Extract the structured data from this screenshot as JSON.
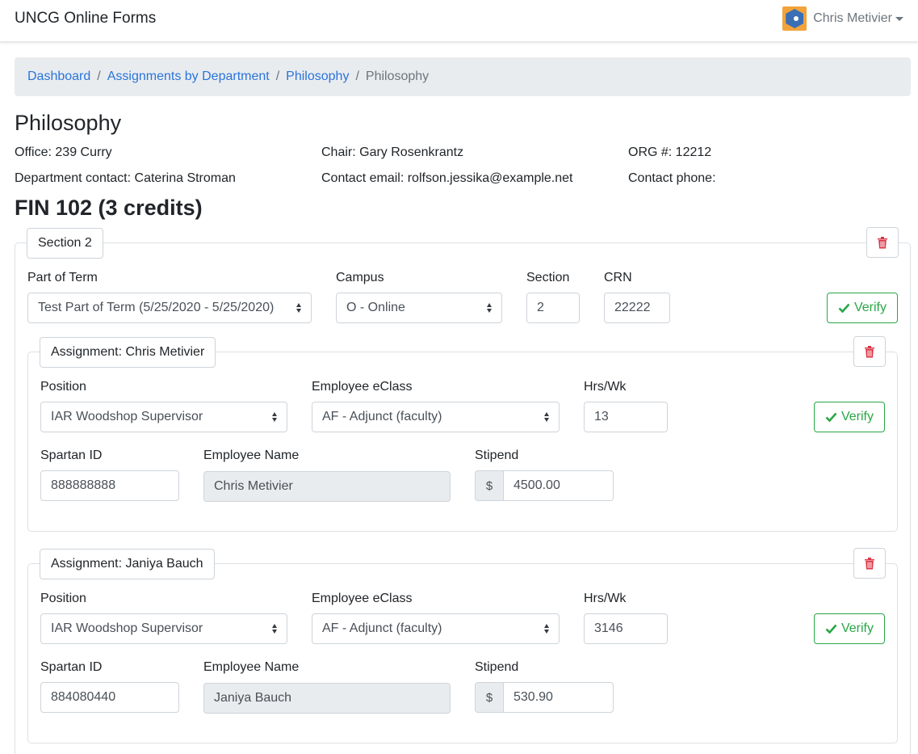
{
  "navbar": {
    "brand": "UNCG Online Forms",
    "user_name": "Chris Metivier",
    "avatar_icon": "avatar-icon"
  },
  "breadcrumb": {
    "items": [
      "Dashboard",
      "Assignments by Department",
      "Philosophy"
    ],
    "active": "Philosophy",
    "separator": "/"
  },
  "department": {
    "title": "Philosophy",
    "office": "Office: 239 Curry",
    "chair": "Chair: Gary Rosenkrantz",
    "org": "ORG #: 12212",
    "contact": "Department contact: Caterina Stroman",
    "email": "Contact email: rolfson.jessika@example.net",
    "phone": "Contact phone:"
  },
  "course": {
    "title": "FIN 102 (3 credits)",
    "section": {
      "legend": "Section 2",
      "labels": {
        "part_of_term": "Part of Term",
        "campus": "Campus",
        "section": "Section",
        "crn": "CRN"
      },
      "part_of_term": "Test Part of Term (5/25/2020 - 5/25/2020)",
      "campus": "O - Online",
      "section_number": "2",
      "crn": "22222",
      "verify_label": "Verify"
    },
    "assignments": [
      {
        "legend": "Assignment: Chris Metivier",
        "labels": {
          "position": "Position",
          "eclass": "Employee eClass",
          "hours": "Hrs/Wk",
          "spartan_id": "Spartan ID",
          "employee_name": "Employee Name",
          "stipend": "Stipend"
        },
        "position": "IAR Woodshop Supervisor",
        "eclass": "AF - Adjunct (faculty)",
        "hours": "13",
        "spartan_id": "888888888",
        "employee_name": "Chris Metivier",
        "currency": "$",
        "stipend": "4500.00",
        "verify_label": "Verify"
      },
      {
        "legend": "Assignment: Janiya Bauch",
        "labels": {
          "position": "Position",
          "eclass": "Employee eClass",
          "hours": "Hrs/Wk",
          "spartan_id": "Spartan ID",
          "employee_name": "Employee Name",
          "stipend": "Stipend"
        },
        "position": "IAR Woodshop Supervisor",
        "eclass": "AF - Adjunct (faculty)",
        "hours": "3146",
        "spartan_id": "884080440",
        "employee_name": "Janiya Bauch",
        "currency": "$",
        "stipend": "530.90",
        "verify_label": "Verify"
      }
    ]
  },
  "colors": {
    "link": "#2a74d9",
    "success": "#28a745",
    "danger": "#dc3545",
    "breadcrumb_bg": "#e9ecef"
  }
}
